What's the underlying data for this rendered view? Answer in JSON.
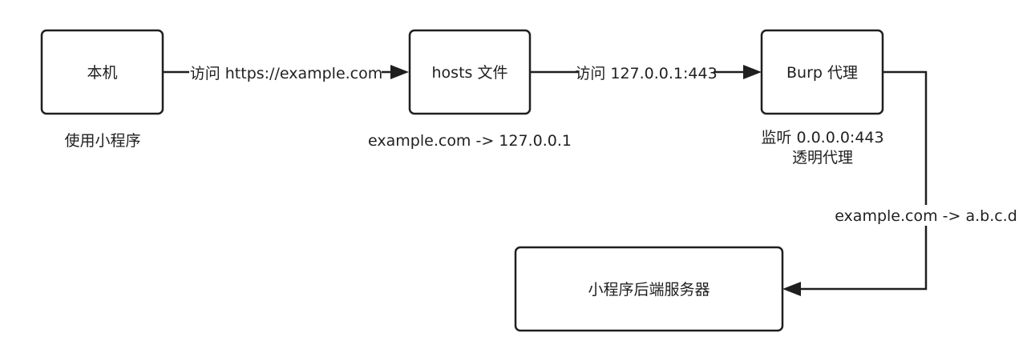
{
  "nodes": {
    "local": {
      "label": "本机"
    },
    "hosts": {
      "label": "hosts 文件"
    },
    "burp": {
      "label": "Burp 代理"
    },
    "server": {
      "label": "小程序后端服务器"
    }
  },
  "captions": {
    "local": "使用小程序",
    "hosts": "example.com -> 127.0.0.1",
    "burp_line1": "监听 0.0.0.0:443",
    "burp_line2": "透明代理"
  },
  "edges": {
    "local_to_hosts": "访问 https://example.com",
    "hosts_to_burp": "访问 127.0.0.1:443",
    "burp_to_server": "example.com -> a.b.c.d"
  }
}
